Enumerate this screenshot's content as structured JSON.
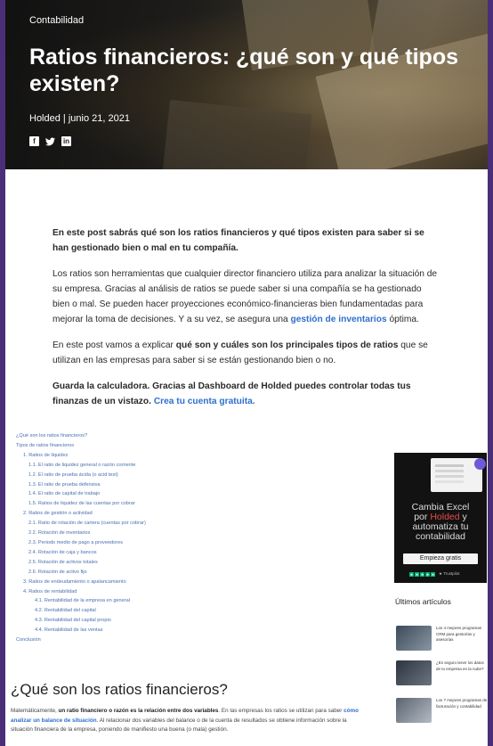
{
  "hero": {
    "category": "Contabilidad",
    "title": "Ratios financieros: ¿qué son y qué tipos existen?",
    "author_date": "Holded | junio 21, 2021",
    "social": [
      "facebook-icon",
      "twitter-icon",
      "linkedin-icon"
    ]
  },
  "intro": {
    "p1": "En este post sabrás qué son los ratios financieros y qué tipos existen para saber si se han gestionado bien o mal en tu compañía.",
    "p2_text": "Los ratios son herramientas que cualquier director financiero utiliza para analizar la situación de su empresa. Gracias al análisis de ratios se puede saber si una compañía se ha gestionado bien o mal. Se pueden hacer proyecciones económico-financieras bien fundamentadas para mejorar la toma de decisiones. Y a su vez, se asegura una",
    "p2_link": "gestión de inventarios",
    "p2_end": "óptima.",
    "p3_start": "En este post vamos a explicar",
    "p3_bold": "qué son y cuáles son los principales tipos de ratios",
    "p3_end": "que se utilizan en las empresas para saber si se están gestionando bien o no.",
    "p4_bold": "Guarda la calculadora. Gracias al Dashboard de Holded puedes controlar todas tus finanzas de un vistazo.",
    "p4_link": "Crea tu cuenta gratuita."
  },
  "toc": [
    {
      "level": 0,
      "text": "¿Qué son los ratios financieros?"
    },
    {
      "level": 0,
      "text": "Tipos de ratios financieros"
    },
    {
      "level": 1,
      "text": "1. Ratios de liquidez"
    },
    {
      "level": 2,
      "text": "1.1. El ratio de liquidez general o razón corriente"
    },
    {
      "level": 2,
      "text": "1.2. El ratio de prueba ácida (o acid test)"
    },
    {
      "level": 2,
      "text": "1.3. El ratio de prueba defensiva"
    },
    {
      "level": 2,
      "text": "1.4. El ratio de capital de trabajo"
    },
    {
      "level": 2,
      "text": "1.5. Ratios de liquidez de las cuentas por cobrar"
    },
    {
      "level": 1,
      "text": "2. Ratios de gestión o actividad"
    },
    {
      "level": 2,
      "text": "2.1. Ratio de rotación de cartera (cuentas por cobrar)"
    },
    {
      "level": 2,
      "text": "2.2. Rotación de inventarios"
    },
    {
      "level": 2,
      "text": "2.3. Periodo medio de pago a proveedores"
    },
    {
      "level": 2,
      "text": "2.4. Rotación de caja y bancos"
    },
    {
      "level": 2,
      "text": "2.5. Rotación de activos totales"
    },
    {
      "level": 2,
      "text": "2.6. Rotación de activo fijo"
    },
    {
      "level": 1,
      "text": "3. Ratios de endeudamiento o apalancamiento"
    },
    {
      "level": 1,
      "text": "4. Ratios de rentabilidad"
    },
    {
      "level": 3,
      "text": "4.1. Rentabilidad de la empresa en general"
    },
    {
      "level": 3,
      "text": "4.2. Rentabilidad del capital"
    },
    {
      "level": 3,
      "text": "4.3. Rentabilidad del capital propio"
    },
    {
      "level": 3,
      "text": "4.4. Rentabilidad de las ventas"
    },
    {
      "level": 0,
      "text": "Conclusión"
    }
  ],
  "section": {
    "heading": "¿Qué son los ratios financieros?",
    "p_start": "Matemáticamente,",
    "p_bold": "un ratio financiero o razón es la relación entre dos variables",
    "p_mid": ". En las empresas los ratios se utilizan para saber",
    "p_link": "cómo analizar un balance de situación",
    "p_end": ". Al relacionar dos variables del balance o de la cuenta de resultados se obtiene información sobre la situación financiera de la empresa, poniendo de manifiesto una buena (o mala) gestión."
  },
  "ad": {
    "line1": "Cambia Excel",
    "line2_a": "por",
    "line2_brand": "Holded",
    "line2_b": "y",
    "line3": "automatiza tu",
    "line4": "contabilidad",
    "button": "Empieza gratis",
    "trust": "Trustpilot",
    "brand_color": "#e8484a"
  },
  "latest": {
    "heading": "Últimos artículos",
    "items": [
      {
        "title": "Los 4 mejores programas CRM para gestorías y asesorías"
      },
      {
        "title": "¿Es seguro tener los datos de tu empresa en la nube?"
      },
      {
        "title": "Los 7 mejores programas de facturación y contabilidad"
      }
    ]
  }
}
